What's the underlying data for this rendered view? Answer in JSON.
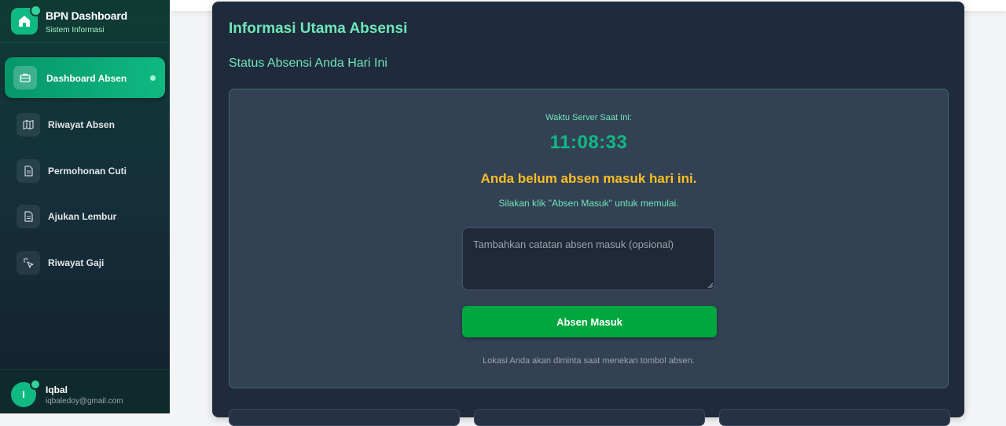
{
  "brand": {
    "title": "BPN Dashboard",
    "subtitle": "Sistem Informasi",
    "icon": "home-icon"
  },
  "sidebar": {
    "items": [
      {
        "label": "Dashboard Absen",
        "icon": "briefcase-icon",
        "active": true
      },
      {
        "label": "Riwayat Absen",
        "icon": "map-icon",
        "active": false
      },
      {
        "label": "Permohonan Cuti",
        "icon": "document-icon",
        "active": false
      },
      {
        "label": "Ajukan Lembur",
        "icon": "document-icon",
        "active": false
      },
      {
        "label": "Riwayat Gaji",
        "icon": "cursor-click-icon",
        "active": false
      }
    ]
  },
  "user": {
    "initial": "I",
    "name": "Iqbal",
    "email": "iqbaledoy@gmail.com"
  },
  "main": {
    "title": "Informasi Utama Absensi",
    "subtitle": "Status Absensi Anda Hari Ini",
    "card": {
      "server_label": "Waktu Server Saat Ini:",
      "server_time": "11:08:33",
      "status_title": "Anda belum absen masuk hari ini.",
      "status_hint": "Silakan klik \"Absen Masuk\" untuk memulai.",
      "note_placeholder": "Tambahkan catatan absen masuk (opsional)",
      "button_label": "Absen Masuk",
      "location_note": "Lokasi Anda akan diminta saat menekan tombol absen."
    }
  },
  "colors": {
    "accent": "#10b981",
    "warning": "#fbbf24",
    "button": "#00a63e"
  }
}
